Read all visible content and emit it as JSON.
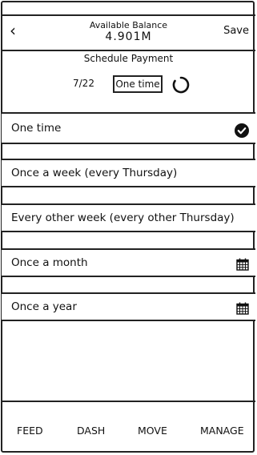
{
  "header": {
    "balance_label": "Available Balance",
    "balance_value": "4.901M",
    "save_label": "Save"
  },
  "schedule": {
    "title": "Schedule Payment",
    "date": "7/22",
    "frequency": "One time"
  },
  "options": [
    {
      "label": "One time",
      "icon": "checkmark-icon",
      "selected": true
    },
    {
      "label": "Once a week (every Thursday)",
      "icon": "",
      "selected": false
    },
    {
      "label": "Every other week (every other Thursday)",
      "icon": "",
      "selected": false
    },
    {
      "label": "Once a month",
      "icon": "calendar-icon",
      "selected": false
    },
    {
      "label": "Once a year",
      "icon": "calendar-icon",
      "selected": false
    }
  ],
  "nav": [
    {
      "label": "FEED"
    },
    {
      "label": "DASH"
    },
    {
      "label": "MOVE"
    },
    {
      "label": "MANAGE"
    }
  ]
}
